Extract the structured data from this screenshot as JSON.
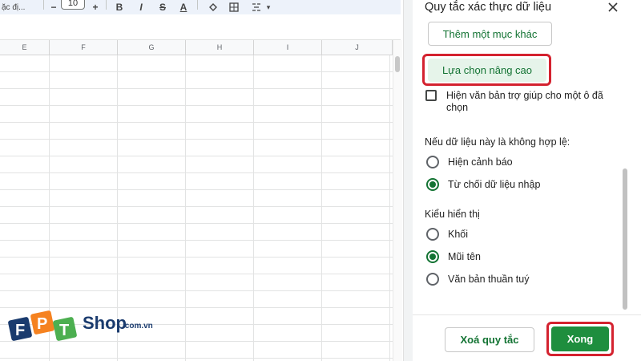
{
  "toolbar": {
    "font_name": "ặc đị...",
    "font_size": "10",
    "decrease_glyph": "−",
    "increase_glyph": "+",
    "bold_glyph": "B",
    "italic_glyph": "I",
    "strike_glyph": "S",
    "color_glyph": "A",
    "more_glyph": "▾"
  },
  "sheet": {
    "columns": [
      "E",
      "F",
      "G",
      "H",
      "I",
      "J"
    ]
  },
  "panel": {
    "title": "Quy tắc xác thực dữ liệu",
    "add_more_label": "Thêm một mục khác",
    "advanced_label": "Lựa chọn nâng cao",
    "help_text_label": "Hiện văn bản trợ giúp cho một ô đã chọn",
    "help_text_checked": false,
    "invalid_section": {
      "label": "Nếu dữ liệu này là không hợp lệ:",
      "options": [
        {
          "label": "Hiện cảnh báo",
          "checked": false
        },
        {
          "label": "Từ chối dữ liệu nhập",
          "checked": true
        }
      ]
    },
    "display_section": {
      "label": "Kiểu hiển thị",
      "options": [
        {
          "label": "Khối",
          "checked": false
        },
        {
          "label": "Mũi tên",
          "checked": true
        },
        {
          "label": "Văn bản thuần tuý",
          "checked": false
        }
      ]
    },
    "clear_label": "Xoá quy tắc",
    "done_label": "Xong"
  },
  "watermark": {
    "brand": "FPT",
    "shop": "Shop",
    "domain": ".com.vn",
    "colors": {
      "blue": "#1a3b6e",
      "orange": "#f58220",
      "green": "#4caf50"
    }
  },
  "colors": {
    "accent_green": "#137333",
    "button_green": "#1e8e3e",
    "highlight_red": "#d4222f"
  }
}
